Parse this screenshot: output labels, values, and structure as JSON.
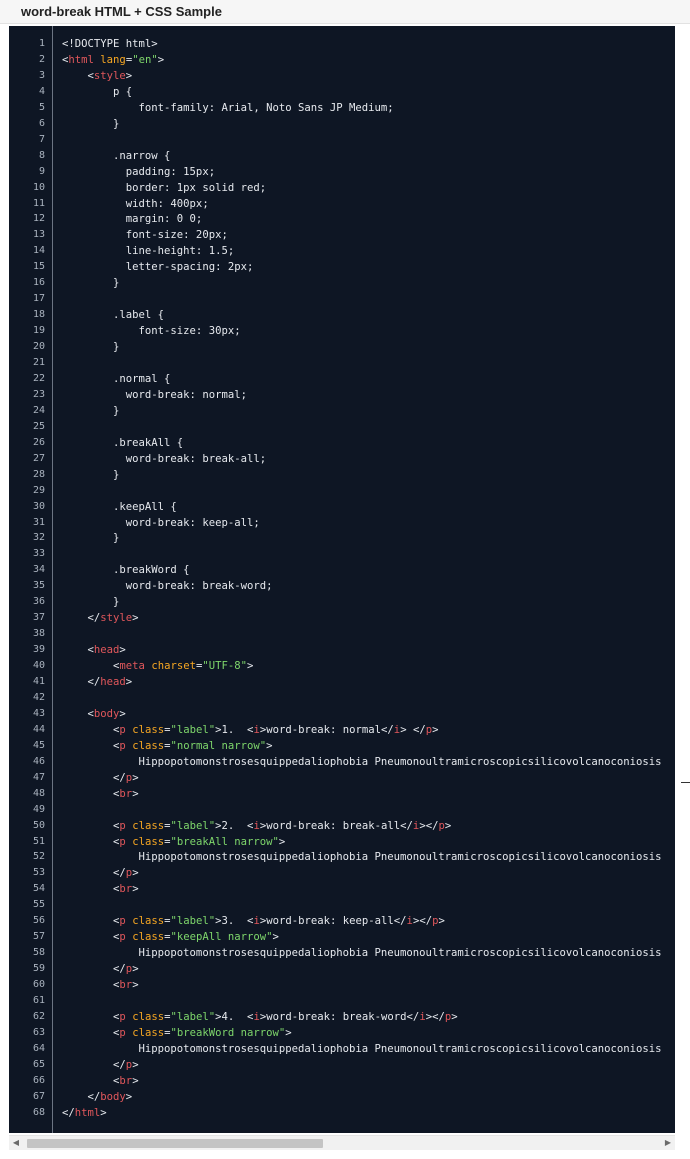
{
  "header": {
    "title": "word-break HTML + CSS Sample"
  },
  "colors": {
    "background": "#0e1624",
    "plain": "#e6e9ee",
    "tag": "#e0575b",
    "attribute": "#f5a623",
    "string": "#7ed66b"
  },
  "scrollbar": {
    "left_arrow": "◀",
    "right_arrow": "▶",
    "thumb_fraction": 0.47
  },
  "code_lines": [
    {
      "n": "1",
      "tokens": [
        {
          "t": "plain",
          "v": "<!DOCTYPE html>"
        }
      ]
    },
    {
      "n": "2",
      "tokens": [
        {
          "t": "punct",
          "v": "<"
        },
        {
          "t": "tag",
          "v": "html"
        },
        {
          "t": "plain",
          "v": " "
        },
        {
          "t": "attr",
          "v": "lang"
        },
        {
          "t": "plain",
          "v": "="
        },
        {
          "t": "str",
          "v": "\"en\""
        },
        {
          "t": "punct",
          "v": ">"
        }
      ]
    },
    {
      "n": "3",
      "tokens": [
        {
          "t": "plain",
          "v": "    "
        },
        {
          "t": "punct",
          "v": "<"
        },
        {
          "t": "tag",
          "v": "style"
        },
        {
          "t": "punct",
          "v": ">"
        }
      ]
    },
    {
      "n": "4",
      "tokens": [
        {
          "t": "plain",
          "v": "        p {"
        }
      ]
    },
    {
      "n": "5",
      "tokens": [
        {
          "t": "plain",
          "v": "            font-family: Arial, Noto Sans JP Medium;"
        }
      ]
    },
    {
      "n": "6",
      "tokens": [
        {
          "t": "plain",
          "v": "        }"
        }
      ]
    },
    {
      "n": "7",
      "tokens": []
    },
    {
      "n": "8",
      "tokens": [
        {
          "t": "plain",
          "v": "        .narrow {"
        }
      ]
    },
    {
      "n": "9",
      "tokens": [
        {
          "t": "plain",
          "v": "          padding: 15px;"
        }
      ]
    },
    {
      "n": "10",
      "tokens": [
        {
          "t": "plain",
          "v": "          border: 1px solid red;"
        }
      ]
    },
    {
      "n": "11",
      "tokens": [
        {
          "t": "plain",
          "v": "          width: 400px;"
        }
      ]
    },
    {
      "n": "12",
      "tokens": [
        {
          "t": "plain",
          "v": "          margin: 0 0;"
        }
      ]
    },
    {
      "n": "13",
      "tokens": [
        {
          "t": "plain",
          "v": "          font-size: 20px;"
        }
      ]
    },
    {
      "n": "14",
      "tokens": [
        {
          "t": "plain",
          "v": "          line-height: 1.5;"
        }
      ]
    },
    {
      "n": "15",
      "tokens": [
        {
          "t": "plain",
          "v": "          letter-spacing: 2px;"
        }
      ]
    },
    {
      "n": "16",
      "tokens": [
        {
          "t": "plain",
          "v": "        }"
        }
      ]
    },
    {
      "n": "17",
      "tokens": []
    },
    {
      "n": "18",
      "tokens": [
        {
          "t": "plain",
          "v": "        .label {"
        }
      ]
    },
    {
      "n": "19",
      "tokens": [
        {
          "t": "plain",
          "v": "            font-size: 30px;"
        }
      ]
    },
    {
      "n": "20",
      "tokens": [
        {
          "t": "plain",
          "v": "        }"
        }
      ]
    },
    {
      "n": "21",
      "tokens": []
    },
    {
      "n": "22",
      "tokens": [
        {
          "t": "plain",
          "v": "        .normal {"
        }
      ]
    },
    {
      "n": "23",
      "tokens": [
        {
          "t": "plain",
          "v": "          word-break: normal;"
        }
      ]
    },
    {
      "n": "24",
      "tokens": [
        {
          "t": "plain",
          "v": "        }"
        }
      ]
    },
    {
      "n": "25",
      "tokens": []
    },
    {
      "n": "26",
      "tokens": [
        {
          "t": "plain",
          "v": "        .breakAll {"
        }
      ]
    },
    {
      "n": "27",
      "tokens": [
        {
          "t": "plain",
          "v": "          word-break: break-all;"
        }
      ]
    },
    {
      "n": "28",
      "tokens": [
        {
          "t": "plain",
          "v": "        }"
        }
      ]
    },
    {
      "n": "29",
      "tokens": []
    },
    {
      "n": "30",
      "tokens": [
        {
          "t": "plain",
          "v": "        .keepAll {"
        }
      ]
    },
    {
      "n": "31",
      "tokens": [
        {
          "t": "plain",
          "v": "          word-break: keep-all;"
        }
      ]
    },
    {
      "n": "32",
      "tokens": [
        {
          "t": "plain",
          "v": "        }"
        }
      ]
    },
    {
      "n": "33",
      "tokens": []
    },
    {
      "n": "34",
      "tokens": [
        {
          "t": "plain",
          "v": "        .breakWord {"
        }
      ]
    },
    {
      "n": "35",
      "tokens": [
        {
          "t": "plain",
          "v": "          word-break: break-word;"
        }
      ]
    },
    {
      "n": "36",
      "tokens": [
        {
          "t": "plain",
          "v": "        }"
        }
      ]
    },
    {
      "n": "37",
      "tokens": [
        {
          "t": "plain",
          "v": "    "
        },
        {
          "t": "punct",
          "v": "</"
        },
        {
          "t": "tag",
          "v": "style"
        },
        {
          "t": "punct",
          "v": ">"
        }
      ]
    },
    {
      "n": "38",
      "tokens": []
    },
    {
      "n": "39",
      "tokens": [
        {
          "t": "plain",
          "v": "    "
        },
        {
          "t": "punct",
          "v": "<"
        },
        {
          "t": "tag",
          "v": "head"
        },
        {
          "t": "punct",
          "v": ">"
        }
      ]
    },
    {
      "n": "40",
      "tokens": [
        {
          "t": "plain",
          "v": "        "
        },
        {
          "t": "punct",
          "v": "<"
        },
        {
          "t": "tag",
          "v": "meta"
        },
        {
          "t": "plain",
          "v": " "
        },
        {
          "t": "attr",
          "v": "charset"
        },
        {
          "t": "plain",
          "v": "="
        },
        {
          "t": "str",
          "v": "\"UTF-8\""
        },
        {
          "t": "punct",
          "v": ">"
        }
      ]
    },
    {
      "n": "41",
      "tokens": [
        {
          "t": "plain",
          "v": "    "
        },
        {
          "t": "punct",
          "v": "</"
        },
        {
          "t": "tag",
          "v": "head"
        },
        {
          "t": "punct",
          "v": ">"
        }
      ]
    },
    {
      "n": "42",
      "tokens": []
    },
    {
      "n": "43",
      "tokens": [
        {
          "t": "plain",
          "v": "    "
        },
        {
          "t": "punct",
          "v": "<"
        },
        {
          "t": "tag",
          "v": "body"
        },
        {
          "t": "punct",
          "v": ">"
        }
      ]
    },
    {
      "n": "44",
      "tokens": [
        {
          "t": "plain",
          "v": "        "
        },
        {
          "t": "punct",
          "v": "<"
        },
        {
          "t": "tag",
          "v": "p"
        },
        {
          "t": "plain",
          "v": " "
        },
        {
          "t": "attr",
          "v": "class"
        },
        {
          "t": "plain",
          "v": "="
        },
        {
          "t": "str",
          "v": "\"label\""
        },
        {
          "t": "punct",
          "v": ">"
        },
        {
          "t": "plain",
          "v": "1.  "
        },
        {
          "t": "punct",
          "v": "<"
        },
        {
          "t": "tag",
          "v": "i"
        },
        {
          "t": "punct",
          "v": ">"
        },
        {
          "t": "plain",
          "v": "word-break: normal"
        },
        {
          "t": "punct",
          "v": "</"
        },
        {
          "t": "tag",
          "v": "i"
        },
        {
          "t": "punct",
          "v": ">"
        },
        {
          "t": "plain",
          "v": " "
        },
        {
          "t": "punct",
          "v": "</"
        },
        {
          "t": "tag",
          "v": "p"
        },
        {
          "t": "punct",
          "v": ">"
        }
      ]
    },
    {
      "n": "45",
      "tokens": [
        {
          "t": "plain",
          "v": "        "
        },
        {
          "t": "punct",
          "v": "<"
        },
        {
          "t": "tag",
          "v": "p"
        },
        {
          "t": "plain",
          "v": " "
        },
        {
          "t": "attr",
          "v": "class"
        },
        {
          "t": "plain",
          "v": "="
        },
        {
          "t": "str",
          "v": "\"normal narrow\""
        },
        {
          "t": "punct",
          "v": ">"
        }
      ]
    },
    {
      "n": "46",
      "tokens": [
        {
          "t": "plain",
          "v": "            Hippopotomonstrosesquippedaliophobia Pneumonoultramicroscopicsilicovolcanoconiosis"
        }
      ]
    },
    {
      "n": "47",
      "tokens": [
        {
          "t": "plain",
          "v": "        "
        },
        {
          "t": "punct",
          "v": "</"
        },
        {
          "t": "tag",
          "v": "p"
        },
        {
          "t": "punct",
          "v": ">"
        }
      ]
    },
    {
      "n": "48",
      "tokens": [
        {
          "t": "plain",
          "v": "        "
        },
        {
          "t": "punct",
          "v": "<"
        },
        {
          "t": "tag",
          "v": "br"
        },
        {
          "t": "punct",
          "v": ">"
        }
      ]
    },
    {
      "n": "49",
      "tokens": []
    },
    {
      "n": "50",
      "tokens": [
        {
          "t": "plain",
          "v": "        "
        },
        {
          "t": "punct",
          "v": "<"
        },
        {
          "t": "tag",
          "v": "p"
        },
        {
          "t": "plain",
          "v": " "
        },
        {
          "t": "attr",
          "v": "class"
        },
        {
          "t": "plain",
          "v": "="
        },
        {
          "t": "str",
          "v": "\"label\""
        },
        {
          "t": "punct",
          "v": ">"
        },
        {
          "t": "plain",
          "v": "2.  "
        },
        {
          "t": "punct",
          "v": "<"
        },
        {
          "t": "tag",
          "v": "i"
        },
        {
          "t": "punct",
          "v": ">"
        },
        {
          "t": "plain",
          "v": "word-break: break-all"
        },
        {
          "t": "punct",
          "v": "</"
        },
        {
          "t": "tag",
          "v": "i"
        },
        {
          "t": "punct",
          "v": ">"
        },
        {
          "t": "punct",
          "v": "</"
        },
        {
          "t": "tag",
          "v": "p"
        },
        {
          "t": "punct",
          "v": ">"
        }
      ]
    },
    {
      "n": "51",
      "tokens": [
        {
          "t": "plain",
          "v": "        "
        },
        {
          "t": "punct",
          "v": "<"
        },
        {
          "t": "tag",
          "v": "p"
        },
        {
          "t": "plain",
          "v": " "
        },
        {
          "t": "attr",
          "v": "class"
        },
        {
          "t": "plain",
          "v": "="
        },
        {
          "t": "str",
          "v": "\"breakAll narrow\""
        },
        {
          "t": "punct",
          "v": ">"
        }
      ]
    },
    {
      "n": "52",
      "tokens": [
        {
          "t": "plain",
          "v": "            Hippopotomonstrosesquippedaliophobia Pneumonoultramicroscopicsilicovolcanoconiosis"
        }
      ]
    },
    {
      "n": "53",
      "tokens": [
        {
          "t": "plain",
          "v": "        "
        },
        {
          "t": "punct",
          "v": "</"
        },
        {
          "t": "tag",
          "v": "p"
        },
        {
          "t": "punct",
          "v": ">"
        }
      ]
    },
    {
      "n": "54",
      "tokens": [
        {
          "t": "plain",
          "v": "        "
        },
        {
          "t": "punct",
          "v": "<"
        },
        {
          "t": "tag",
          "v": "br"
        },
        {
          "t": "punct",
          "v": ">"
        }
      ]
    },
    {
      "n": "55",
      "tokens": []
    },
    {
      "n": "56",
      "tokens": [
        {
          "t": "plain",
          "v": "        "
        },
        {
          "t": "punct",
          "v": "<"
        },
        {
          "t": "tag",
          "v": "p"
        },
        {
          "t": "plain",
          "v": " "
        },
        {
          "t": "attr",
          "v": "class"
        },
        {
          "t": "plain",
          "v": "="
        },
        {
          "t": "str",
          "v": "\"label\""
        },
        {
          "t": "punct",
          "v": ">"
        },
        {
          "t": "plain",
          "v": "3.  "
        },
        {
          "t": "punct",
          "v": "<"
        },
        {
          "t": "tag",
          "v": "i"
        },
        {
          "t": "punct",
          "v": ">"
        },
        {
          "t": "plain",
          "v": "word-break: keep-all"
        },
        {
          "t": "punct",
          "v": "</"
        },
        {
          "t": "tag",
          "v": "i"
        },
        {
          "t": "punct",
          "v": ">"
        },
        {
          "t": "punct",
          "v": "</"
        },
        {
          "t": "tag",
          "v": "p"
        },
        {
          "t": "punct",
          "v": ">"
        }
      ]
    },
    {
      "n": "57",
      "tokens": [
        {
          "t": "plain",
          "v": "        "
        },
        {
          "t": "punct",
          "v": "<"
        },
        {
          "t": "tag",
          "v": "p"
        },
        {
          "t": "plain",
          "v": " "
        },
        {
          "t": "attr",
          "v": "class"
        },
        {
          "t": "plain",
          "v": "="
        },
        {
          "t": "str",
          "v": "\"keepAll narrow\""
        },
        {
          "t": "punct",
          "v": ">"
        }
      ]
    },
    {
      "n": "58",
      "tokens": [
        {
          "t": "plain",
          "v": "            Hippopotomonstrosesquippedaliophobia Pneumonoultramicroscopicsilicovolcanoconiosis"
        }
      ]
    },
    {
      "n": "59",
      "tokens": [
        {
          "t": "plain",
          "v": "        "
        },
        {
          "t": "punct",
          "v": "</"
        },
        {
          "t": "tag",
          "v": "p"
        },
        {
          "t": "punct",
          "v": ">"
        }
      ]
    },
    {
      "n": "60",
      "tokens": [
        {
          "t": "plain",
          "v": "        "
        },
        {
          "t": "punct",
          "v": "<"
        },
        {
          "t": "tag",
          "v": "br"
        },
        {
          "t": "punct",
          "v": ">"
        }
      ]
    },
    {
      "n": "61",
      "tokens": []
    },
    {
      "n": "62",
      "tokens": [
        {
          "t": "plain",
          "v": "        "
        },
        {
          "t": "punct",
          "v": "<"
        },
        {
          "t": "tag",
          "v": "p"
        },
        {
          "t": "plain",
          "v": " "
        },
        {
          "t": "attr",
          "v": "class"
        },
        {
          "t": "plain",
          "v": "="
        },
        {
          "t": "str",
          "v": "\"label\""
        },
        {
          "t": "punct",
          "v": ">"
        },
        {
          "t": "plain",
          "v": "4.  "
        },
        {
          "t": "punct",
          "v": "<"
        },
        {
          "t": "tag",
          "v": "i"
        },
        {
          "t": "punct",
          "v": ">"
        },
        {
          "t": "plain",
          "v": "word-break: break-word"
        },
        {
          "t": "punct",
          "v": "</"
        },
        {
          "t": "tag",
          "v": "i"
        },
        {
          "t": "punct",
          "v": ">"
        },
        {
          "t": "punct",
          "v": "</"
        },
        {
          "t": "tag",
          "v": "p"
        },
        {
          "t": "punct",
          "v": ">"
        }
      ]
    },
    {
      "n": "63",
      "tokens": [
        {
          "t": "plain",
          "v": "        "
        },
        {
          "t": "punct",
          "v": "<"
        },
        {
          "t": "tag",
          "v": "p"
        },
        {
          "t": "plain",
          "v": " "
        },
        {
          "t": "attr",
          "v": "class"
        },
        {
          "t": "plain",
          "v": "="
        },
        {
          "t": "str",
          "v": "\"breakWord narrow\""
        },
        {
          "t": "punct",
          "v": ">"
        }
      ]
    },
    {
      "n": "64",
      "tokens": [
        {
          "t": "plain",
          "v": "            Hippopotomonstrosesquippedaliophobia Pneumonoultramicroscopicsilicovolcanoconiosis"
        }
      ]
    },
    {
      "n": "65",
      "tokens": [
        {
          "t": "plain",
          "v": "        "
        },
        {
          "t": "punct",
          "v": "</"
        },
        {
          "t": "tag",
          "v": "p"
        },
        {
          "t": "punct",
          "v": ">"
        }
      ]
    },
    {
      "n": "66",
      "tokens": [
        {
          "t": "plain",
          "v": "        "
        },
        {
          "t": "punct",
          "v": "<"
        },
        {
          "t": "tag",
          "v": "br"
        },
        {
          "t": "punct",
          "v": ">"
        }
      ]
    },
    {
      "n": "67",
      "tokens": [
        {
          "t": "plain",
          "v": "    "
        },
        {
          "t": "punct",
          "v": "</"
        },
        {
          "t": "tag",
          "v": "body"
        },
        {
          "t": "punct",
          "v": ">"
        }
      ]
    },
    {
      "n": "68",
      "tokens": [
        {
          "t": "punct",
          "v": "</"
        },
        {
          "t": "tag",
          "v": "html"
        },
        {
          "t": "punct",
          "v": ">"
        }
      ]
    }
  ]
}
